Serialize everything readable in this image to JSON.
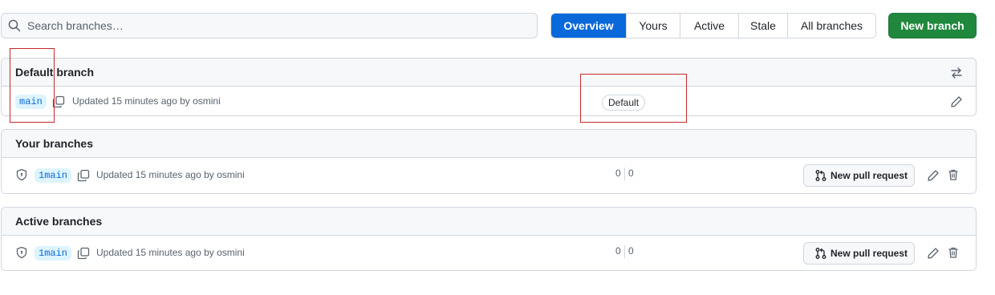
{
  "search": {
    "placeholder": "Search branches…"
  },
  "tabs": [
    {
      "label": "Overview",
      "active": true
    },
    {
      "label": "Yours",
      "active": false
    },
    {
      "label": "Active",
      "active": false
    },
    {
      "label": "Stale",
      "active": false
    },
    {
      "label": "All branches",
      "active": false
    }
  ],
  "new_branch_label": "New branch",
  "default_section": {
    "title": "Default branch",
    "branch": "main",
    "updated": "Updated 15 minutes ago by osmini",
    "badge": "Default"
  },
  "your_section": {
    "title": "Your branches",
    "branch": "1main",
    "updated": "Updated 15 minutes ago by osmini",
    "behind": "0",
    "ahead": "0",
    "pr_label": "New pull request"
  },
  "active_section": {
    "title": "Active branches",
    "branch": "1main",
    "updated": "Updated 15 minutes ago by osmini",
    "behind": "0",
    "ahead": "0",
    "pr_label": "New pull request"
  },
  "colors": {
    "primary": "#0969da",
    "success": "#1f883d",
    "annotation": "#c62828"
  }
}
